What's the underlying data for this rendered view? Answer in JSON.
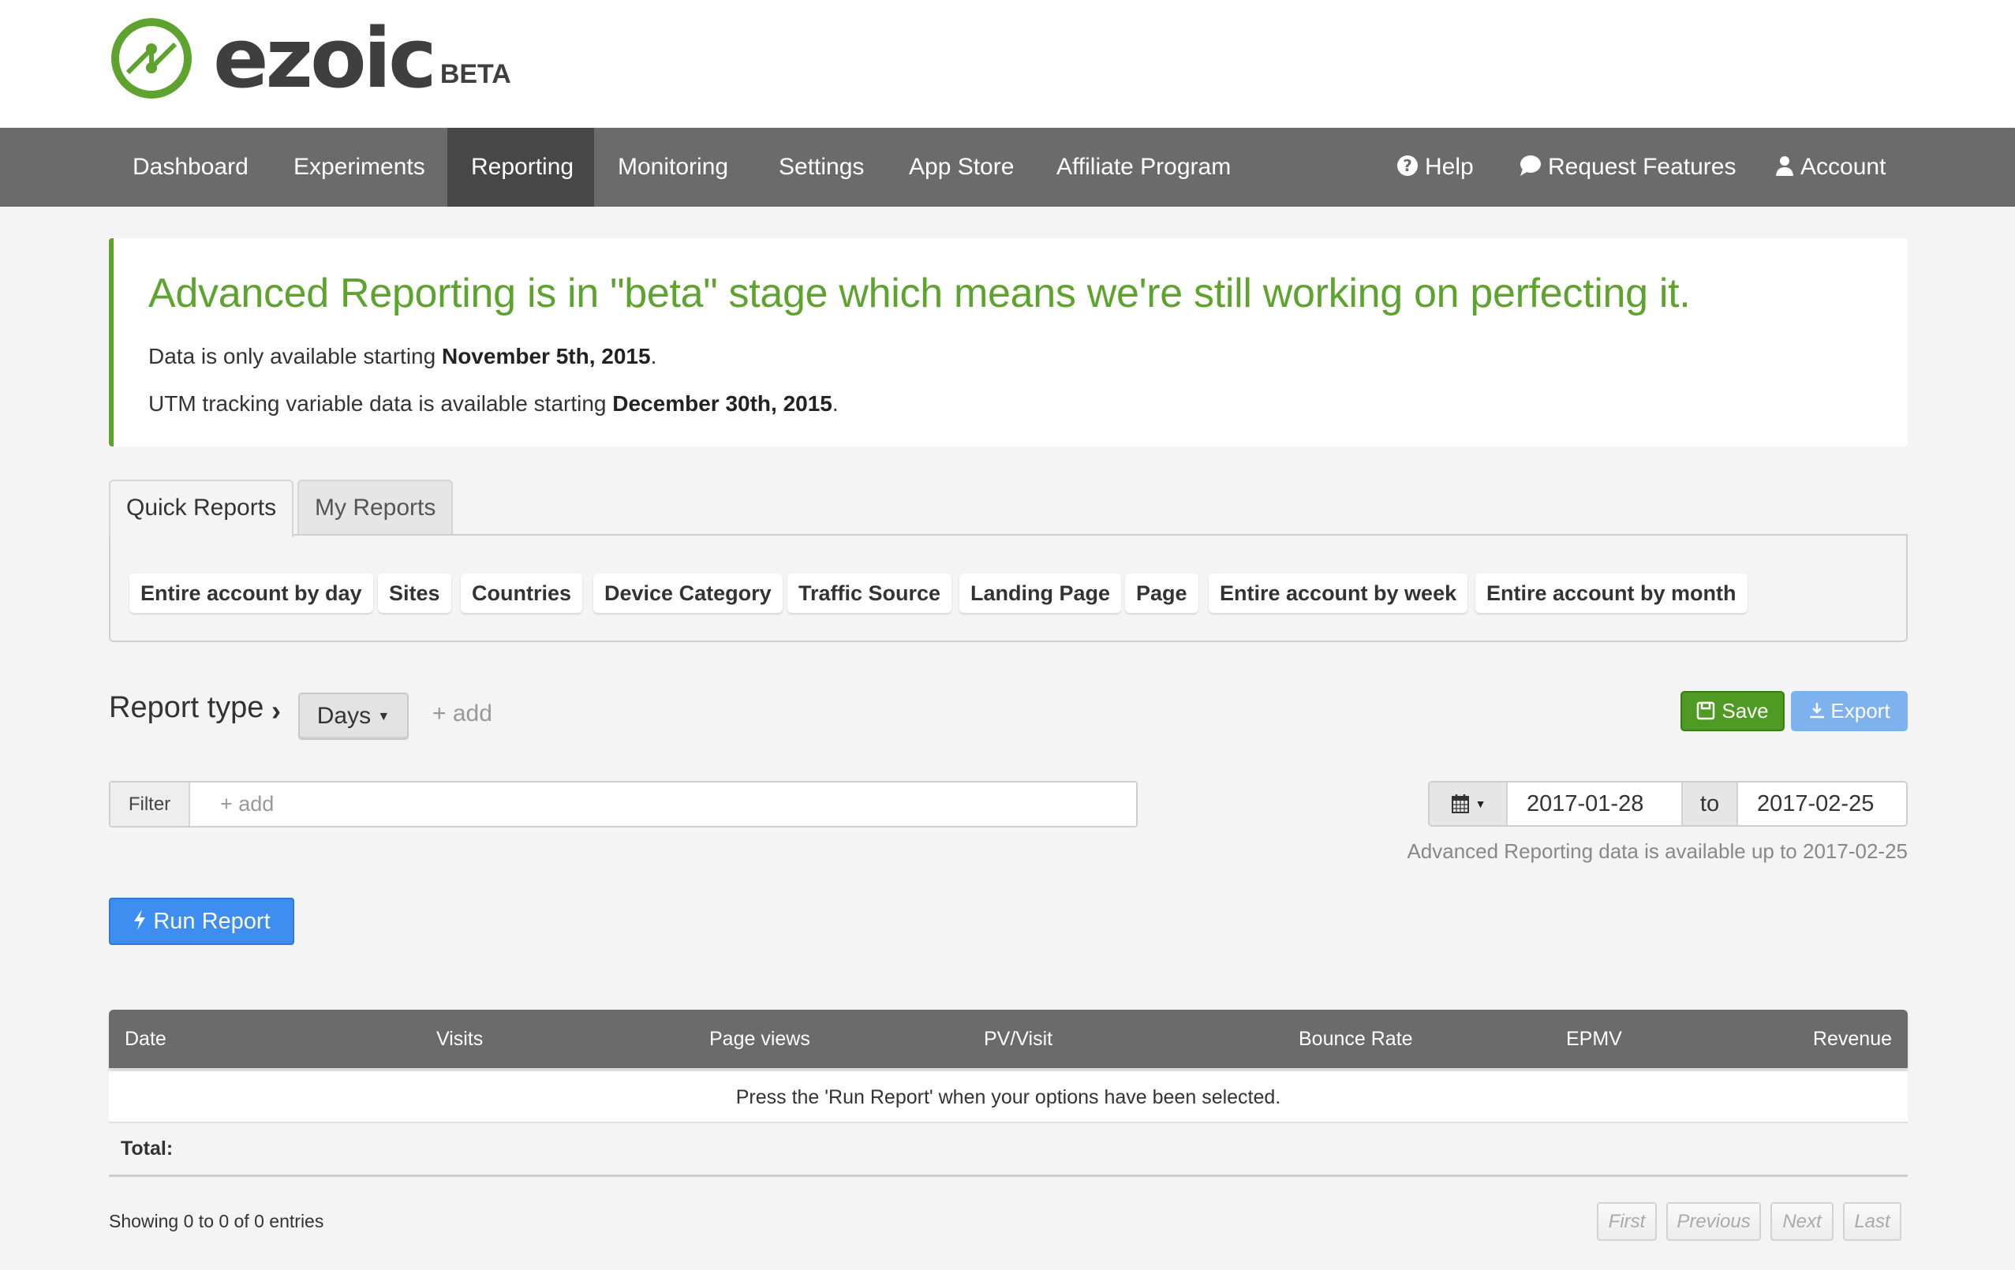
{
  "brand": {
    "name": "ezoic",
    "badge": "BETA",
    "accent_color": "#5ea32e"
  },
  "nav": {
    "left_items": [
      {
        "label": "Dashboard",
        "active": false
      },
      {
        "label": "Experiments",
        "active": false
      },
      {
        "label": "Reporting",
        "active": true
      },
      {
        "label": "Monitoring",
        "active": false
      },
      {
        "label": "Settings",
        "active": false
      },
      {
        "label": "App Store",
        "active": false
      },
      {
        "label": "Affiliate Program",
        "active": false
      }
    ],
    "right_items": [
      {
        "label": "Help",
        "icon": "question-circle-icon"
      },
      {
        "label": "Request Features",
        "icon": "speech-bubble-icon"
      },
      {
        "label": "Account",
        "icon": "user-icon"
      }
    ]
  },
  "banner": {
    "heading": "Advanced Reporting is in \"beta\" stage which means we're still working on perfecting it.",
    "line1_prefix": "Data is only available starting ",
    "line1_bold": "November 5th, 2015",
    "line1_suffix": ".",
    "line2_prefix": "UTM tracking variable data is available starting ",
    "line2_bold": "December 30th, 2015",
    "line2_suffix": "."
  },
  "tabs": [
    {
      "label": "Quick Reports",
      "active": true
    },
    {
      "label": "My Reports",
      "active": false
    }
  ],
  "quick_reports": [
    "Entire account by day",
    "Sites",
    "Countries",
    "Device Category",
    "Traffic Source",
    "Landing Page",
    "Page",
    "Entire account by week",
    "Entire account by month"
  ],
  "report_type": {
    "label": "Report type",
    "chevron": "›",
    "selected": "Days",
    "add_label": "+ add"
  },
  "actions": {
    "save_label": "Save",
    "export_label": "Export",
    "save_color": "#4f9a22",
    "export_color": "#7eb2ef"
  },
  "filter": {
    "label": "Filter",
    "placeholder": "+ add",
    "value": ""
  },
  "date_range": {
    "start": "2017-01-28",
    "separator": "to",
    "end": "2017-02-25",
    "note": "Advanced Reporting data is available up to 2017-02-25"
  },
  "run_report": {
    "label": "Run Report",
    "color": "#3d8ef0"
  },
  "table": {
    "columns": [
      "Date",
      "Visits",
      "Page views",
      "PV/Visit",
      "Bounce Rate",
      "EPMV",
      "Revenue"
    ],
    "empty_message": "Press the 'Run Report' when your options have been selected.",
    "total_label": "Total:"
  },
  "pagination": {
    "info": "Showing 0 to 0 of 0 entries",
    "buttons": [
      "First",
      "Previous",
      "Next",
      "Last"
    ]
  }
}
